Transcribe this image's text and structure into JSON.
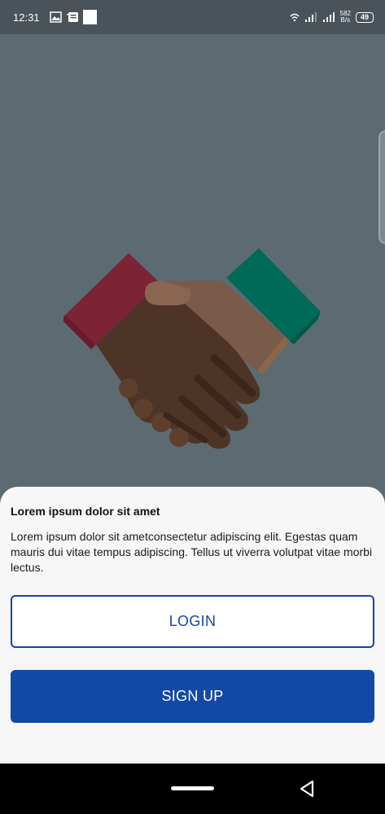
{
  "status_bar": {
    "time": "12:31",
    "net_speed_value": "582",
    "net_speed_unit": "B/s",
    "battery_level": "49",
    "icons": [
      "image-icon",
      "notification-icon",
      "white-square-icon",
      "wifi-icon",
      "signal-icon",
      "signal-icon"
    ]
  },
  "sheet": {
    "title": "Lorem ipsum dolor sit amet",
    "body": "Lorem ipsum dolor sit ametconsectetur adipiscing elit. Egestas quam mauris dui vitae tempus adipiscing. Tellus ut viverra volutpat vitae morbi lectus.",
    "login_label": "LOGIN",
    "signup_label": "SIGN UP"
  },
  "colors": {
    "background": "#5c6b72",
    "primary": "#1249a6",
    "sheet": "#f7f7f7"
  },
  "illustration": {
    "name": "handshake-illustration"
  }
}
